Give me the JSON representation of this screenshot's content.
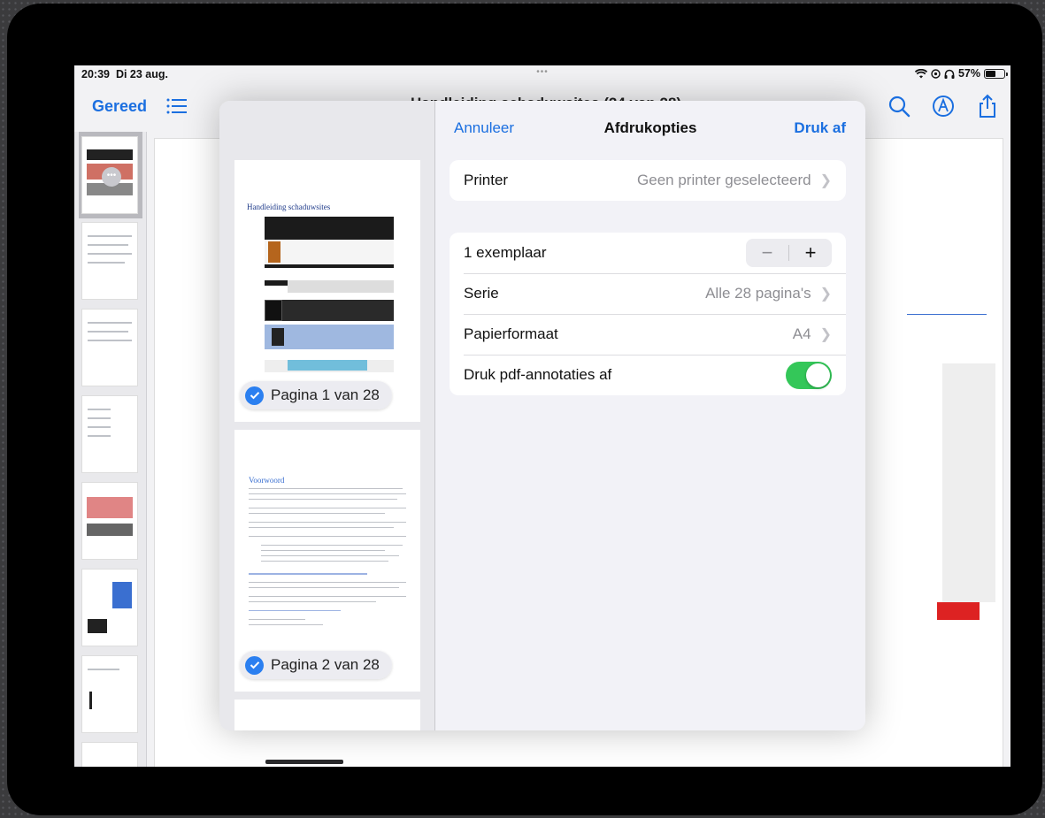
{
  "status": {
    "time": "20:39",
    "date": "Di 23 aug.",
    "dots": "•••",
    "battery_percent": "57%",
    "battery_level": 0.57
  },
  "nav": {
    "done_label": "Gereed",
    "title": "Handleiding schaduwsites (24 van 28)"
  },
  "print_sheet": {
    "cancel_label": "Annuleer",
    "title": "Afdrukopties",
    "print_label": "Druk af",
    "printer_label": "Printer",
    "printer_value": "Geen printer geselecteerd",
    "copies_label": "1 exemplaar",
    "range_label": "Serie",
    "range_value": "Alle 28 pagina's",
    "paper_label": "Papierformaat",
    "paper_value": "A4",
    "annotations_label": "Druk pdf-annotaties af",
    "annotations_on": true,
    "stepper_minus": "−",
    "stepper_plus": "+"
  },
  "pages": [
    {
      "badge": "Pagina 1 van 28",
      "heading": "Handleiding schaduwsites"
    },
    {
      "badge": "Pagina 2 van 28",
      "heading": "Voorwoord"
    }
  ],
  "colors": {
    "accent": "#1b6fe0",
    "toggle_on": "#34c759",
    "check": "#2b7ff0"
  }
}
